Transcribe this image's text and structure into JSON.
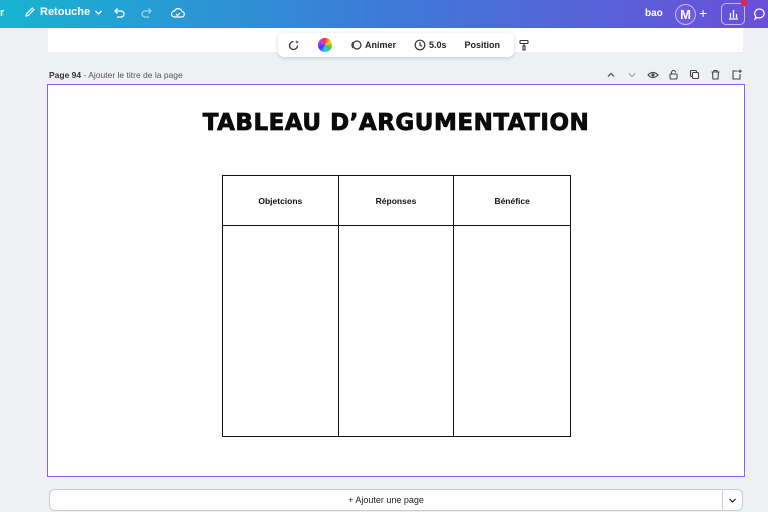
{
  "topbar": {
    "edge_label": "r",
    "retouche_label": "Retouche",
    "user_label": "bao",
    "avatar_initial": "M",
    "plus_label": "+"
  },
  "toolbar": {
    "animate_label": "Animer",
    "duration_label": "5.0s",
    "position_label": "Position"
  },
  "page": {
    "number_label": "Page 94",
    "title_placeholder": " - Ajouter le titre de la page"
  },
  "canvas": {
    "title": "TABLEAU D’ARGUMENTATION",
    "table": {
      "headers": [
        "Objetcions",
        "Réponses",
        "Bénéfice"
      ]
    }
  },
  "footer": {
    "add_page_label": "+ Ajouter une page"
  },
  "colors": {
    "accent_border": "#8b5cf6",
    "notification": "#ee2233"
  }
}
